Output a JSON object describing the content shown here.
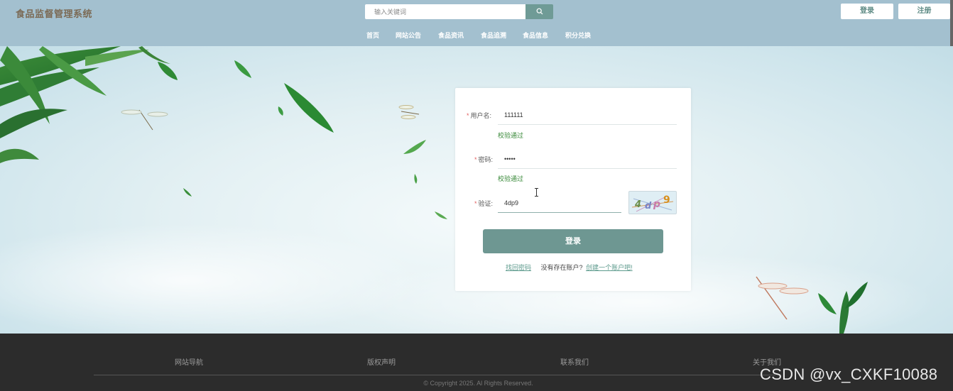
{
  "header": {
    "logo": "食品监督管理系统",
    "search": {
      "placeholder": "输入关键词"
    },
    "login_label": "登录",
    "register_label": "注册",
    "nav": [
      "首页",
      "网站公告",
      "食品资讯",
      "食品追溯",
      "食品信息",
      "积分兑换"
    ]
  },
  "login_form": {
    "username": {
      "label": "用户名:",
      "value": "111111",
      "status": "校验通过"
    },
    "password": {
      "label": "密码:",
      "value": "•••••",
      "status": "校验通过"
    },
    "captcha": {
      "label": "验证:",
      "value": "4dp9",
      "image_text": "4dp9"
    },
    "submit_label": "登录",
    "forgot_link": "找回密码",
    "no_account_text": "没有存在账户?",
    "create_link": "创建一个账户吧!"
  },
  "footer": {
    "items": [
      "网站导航",
      "版权声明",
      "联系我们",
      "关于我们"
    ],
    "copyright": "© Copyright 2025. Al Rights Reserved."
  },
  "watermark": "CSDN @vx_CXKF10088",
  "colors": {
    "header_bg": "#a3c0cf",
    "accent": "#6e9792",
    "footer_bg": "#2c2c2c",
    "valid": "#3a8a3a"
  }
}
